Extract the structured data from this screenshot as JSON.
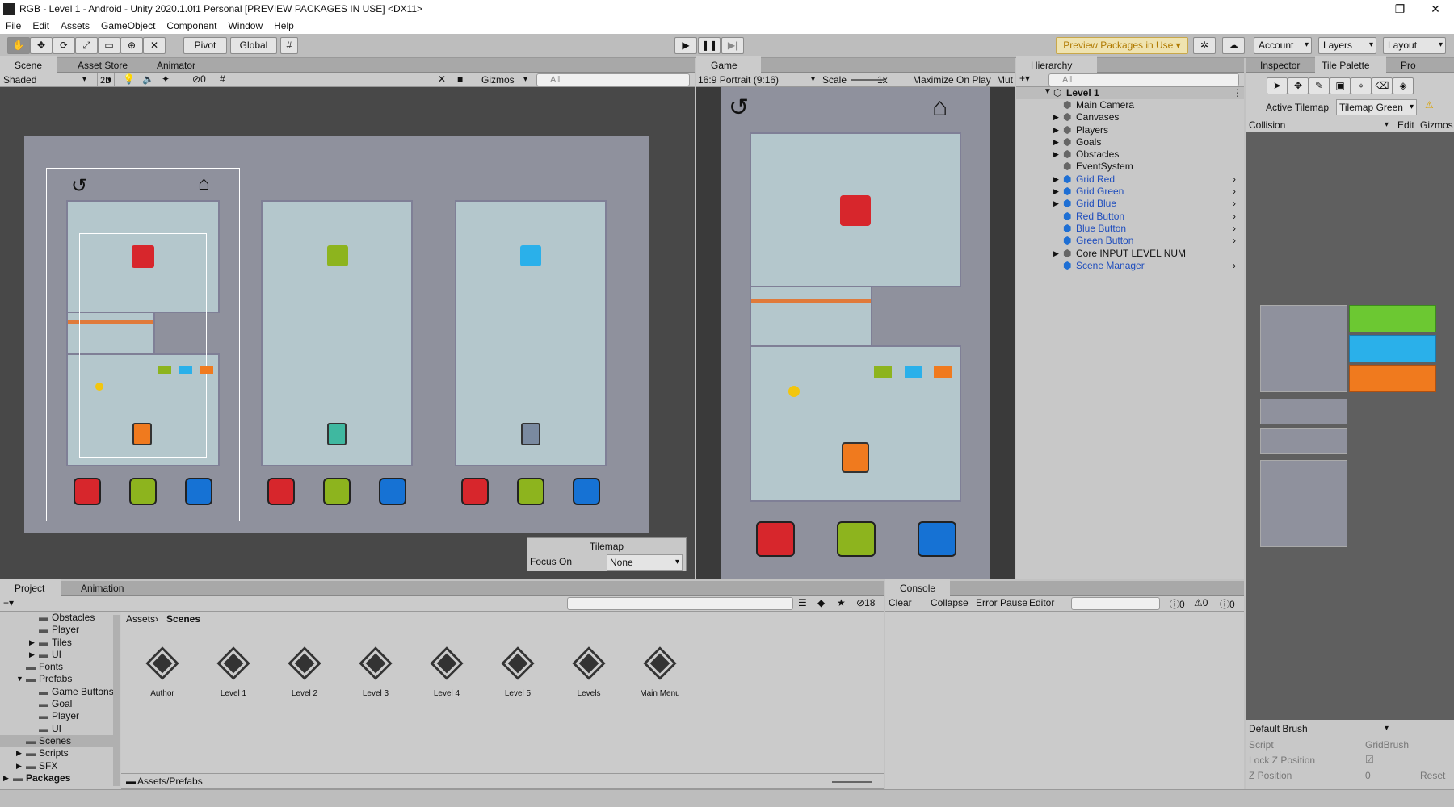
{
  "window": {
    "title": "RGB - Level 1 - Android - Unity 2020.1.0f1 Personal [PREVIEW PACKAGES IN USE] <DX11>",
    "minimize": "—",
    "maximize": "❐",
    "close": "✕"
  },
  "menu": [
    "File",
    "Edit",
    "Assets",
    "GameObject",
    "Component",
    "Window",
    "Help"
  ],
  "toolbar": {
    "pivot": "Pivot",
    "global": "Global",
    "preview_packages": "Preview Packages in Use",
    "account": "Account",
    "layers": "Layers",
    "layout": "Layout"
  },
  "scene": {
    "tabs": [
      "Scene",
      "Asset Store",
      "Animator"
    ],
    "shading": "Shaded",
    "mode_2d": "2D",
    "hidden_count": "0",
    "gizmos": "Gizmos",
    "search_placeholder": "All",
    "overlay": {
      "title": "Tilemap",
      "focus_label": "Focus On",
      "focus_value": "None"
    }
  },
  "game": {
    "tab": "Game",
    "aspect": "16:9 Portrait (9:16)",
    "scale_label": "Scale",
    "scale_value": "1x",
    "maximize": "Maximize On Play",
    "mute": "Mut"
  },
  "hierarchy": {
    "tab": "Hierarchy",
    "search_placeholder": "All",
    "root": "Level 1",
    "items": [
      {
        "label": "Main Camera",
        "prefab": false,
        "expand": false
      },
      {
        "label": "Canvases",
        "prefab": false,
        "expand": true
      },
      {
        "label": "Players",
        "prefab": false,
        "expand": true
      },
      {
        "label": "Goals",
        "prefab": false,
        "expand": true
      },
      {
        "label": "Obstacles",
        "prefab": false,
        "expand": true
      },
      {
        "label": "EventSystem",
        "prefab": false,
        "expand": false
      },
      {
        "label": "Grid Red",
        "prefab": true,
        "expand": true
      },
      {
        "label": "Grid Green",
        "prefab": true,
        "expand": true
      },
      {
        "label": "Grid Blue",
        "prefab": true,
        "expand": true
      },
      {
        "label": "Red Button",
        "prefab": true,
        "expand": false
      },
      {
        "label": "Blue Button",
        "prefab": true,
        "expand": false
      },
      {
        "label": "Green Button",
        "prefab": true,
        "expand": false
      },
      {
        "label": "Core INPUT LEVEL NUM",
        "prefab": false,
        "expand": true
      },
      {
        "label": "Scene Manager",
        "prefab": true,
        "expand": false
      }
    ]
  },
  "palette": {
    "tabs": [
      "Inspector",
      "Tile Palette",
      "Pro"
    ],
    "active_label": "Active Tilemap",
    "active_value": "Tilemap Green",
    "palette_name": "Collision",
    "edit": "Edit",
    "gizmos": "Gizmos",
    "brush": "Default Brush",
    "script_label": "Script",
    "script_value": "GridBrush",
    "lockz_label": "Lock Z Position",
    "zpos_label": "Z Position",
    "zpos_value": "0",
    "reset": "Reset"
  },
  "project": {
    "tabs": [
      "Project",
      "Animation"
    ],
    "tree": [
      {
        "label": "Obstacles",
        "depth": 2,
        "arrow": ""
      },
      {
        "label": "Player",
        "depth": 2,
        "arrow": ""
      },
      {
        "label": "Tiles",
        "depth": 2,
        "arrow": "▶"
      },
      {
        "label": "UI",
        "depth": 2,
        "arrow": "▶"
      },
      {
        "label": "Fonts",
        "depth": 1,
        "arrow": ""
      },
      {
        "label": "Prefabs",
        "depth": 1,
        "arrow": "▼"
      },
      {
        "label": "Game Buttons",
        "depth": 2,
        "arrow": ""
      },
      {
        "label": "Goal",
        "depth": 2,
        "arrow": ""
      },
      {
        "label": "Player",
        "depth": 2,
        "arrow": ""
      },
      {
        "label": "UI",
        "depth": 2,
        "arrow": ""
      },
      {
        "label": "Scenes",
        "depth": 1,
        "arrow": ""
      },
      {
        "label": "Scripts",
        "depth": 1,
        "arrow": "▶"
      },
      {
        "label": "SFX",
        "depth": 1,
        "arrow": "▶"
      },
      {
        "label": "Packages",
        "depth": 0,
        "arrow": "▶"
      }
    ],
    "breadcrumb": [
      "Assets",
      "Scenes"
    ],
    "hidden_count": "18",
    "assets": [
      "Author",
      "Level 1",
      "Level 2",
      "Level 3",
      "Level 4",
      "Level 5",
      "Levels",
      "Main Menu"
    ],
    "footer_path": "Assets/Prefabs"
  },
  "console": {
    "tab": "Console",
    "clear": "Clear",
    "collapse": "Collapse",
    "error_pause": "Error Pause",
    "editor": "Editor",
    "info_count": "0",
    "warn_count": "0",
    "error_count": "0"
  },
  "colors": {
    "red": "#d7262c",
    "green": "#8db41e",
    "blue": "#1672d4",
    "orange": "#f07a1e",
    "cyan": "#2ab0ea",
    "floor": "#b4c7cc",
    "bg": "#8f919d"
  }
}
